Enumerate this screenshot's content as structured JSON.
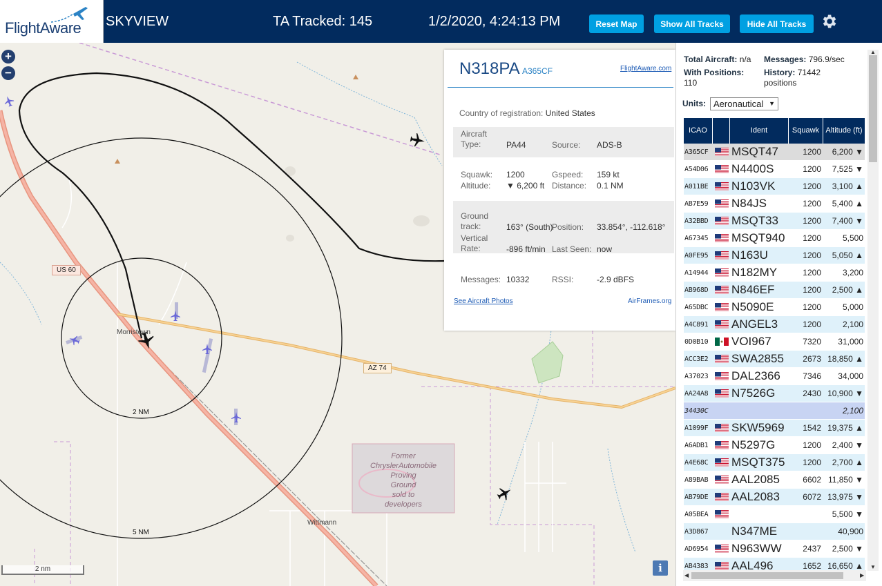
{
  "header": {
    "logo_text": "FlightAware",
    "app_name": "SKYVIEW",
    "tracked_label": "TA Tracked: 145",
    "datetime": "1/2/2020, 4:24:13 PM",
    "buttons": {
      "reset": "Reset Map",
      "show_all": "Show All Tracks",
      "hide_all": "Hide All Tracks"
    },
    "colors": {
      "bar": "#022b5e",
      "button": "#00a0e2"
    }
  },
  "map": {
    "zoom_in": "+",
    "zoom_out": "−",
    "labels": {
      "us60": "US 60",
      "az74": "AZ 74",
      "morristown": "Morristown",
      "wittmann": "Wittmann",
      "ring_2": "2 NM",
      "ring_5": "5 NM",
      "proving_ground": [
        "Former",
        "ChryslerAutomobile",
        "Proving",
        "Ground",
        "sold to",
        "developers"
      ]
    },
    "scale": "2 nm",
    "info_icon": "i"
  },
  "aircraft_panel": {
    "registration": "N318PA",
    "hex": "A365CF",
    "fa_link": "FlightAware.com",
    "country_label": "Country of registration:",
    "country": "United States",
    "aircraft_type_label": "Aircraft Type:",
    "aircraft_type": "PA44",
    "source_label": "Source:",
    "source": "ADS-B",
    "squawk_label": "Squawk:",
    "squawk": "1200",
    "gspeed_label": "Gspeed:",
    "gspeed": "159 kt",
    "altitude_label": "Altitude:",
    "altitude": "▼ 6,200 ft",
    "distance_label": "Distance:",
    "distance": "0.1 NM",
    "ground_track_label": "Ground track:",
    "ground_track": "163° (South)",
    "position_label": "Position:",
    "position": "33.854°, -112.618°",
    "vertical_rate_label": "Vertical Rate:",
    "vertical_rate": "-896 ft/min",
    "last_seen_label": "Last Seen:",
    "last_seen": "now",
    "messages_label": "Messages:",
    "messages": "10332",
    "rssi_label": "RSSI:",
    "rssi": "-2.9 dBFS",
    "photos_link": "See Aircraft Photos",
    "airframes_link": "AirFrames.org"
  },
  "sidebar": {
    "total_aircraft_label": "Total Aircraft:",
    "total_aircraft": "n/a",
    "messages_label": "Messages:",
    "messages": "796.9/sec",
    "with_positions_label": "With Positions:",
    "with_positions": "110",
    "history_label": "History:",
    "history": "71442 positions",
    "units_label": "Units:",
    "units_value": "Aeronautical",
    "columns": [
      "ICAO",
      "",
      "Ident",
      "Squawk",
      "Altitude (ft)"
    ],
    "rows": [
      {
        "icao": "A365CF",
        "flag": "us",
        "ident": "MSQT47",
        "squawk": "1200",
        "alt": "6,200 ▼",
        "style": "sel"
      },
      {
        "icao": "A54D06",
        "flag": "us",
        "ident": "N4400S",
        "squawk": "1200",
        "alt": "7,525 ▼",
        "style": "even"
      },
      {
        "icao": "A011BE",
        "flag": "us",
        "ident": "N103VK",
        "squawk": "1200",
        "alt": "3,100 ▲",
        "style": "odd"
      },
      {
        "icao": "AB7E59",
        "flag": "us",
        "ident": "N84JS",
        "squawk": "1200",
        "alt": "5,400 ▲",
        "style": "even"
      },
      {
        "icao": "A32BBD",
        "flag": "us",
        "ident": "MSQT33",
        "squawk": "1200",
        "alt": "7,400 ▼",
        "style": "odd"
      },
      {
        "icao": "A67345",
        "flag": "us",
        "ident": "MSQT940",
        "squawk": "1200",
        "alt": "5,500",
        "style": "even"
      },
      {
        "icao": "A0FE95",
        "flag": "us",
        "ident": "N163U",
        "squawk": "1200",
        "alt": "5,050 ▲",
        "style": "odd"
      },
      {
        "icao": "A14944",
        "flag": "us",
        "ident": "N182MY",
        "squawk": "1200",
        "alt": "3,200",
        "style": "even"
      },
      {
        "icao": "AB968D",
        "flag": "us",
        "ident": "N846EF",
        "squawk": "1200",
        "alt": "2,500 ▲",
        "style": "odd"
      },
      {
        "icao": "A65DBC",
        "flag": "us",
        "ident": "N5090E",
        "squawk": "1200",
        "alt": "5,000",
        "style": "even"
      },
      {
        "icao": "A4C891",
        "flag": "us",
        "ident": "ANGEL3",
        "squawk": "1200",
        "alt": "2,100",
        "style": "odd"
      },
      {
        "icao": "0D0B10",
        "flag": "mx",
        "ident": "VOI967",
        "squawk": "7320",
        "alt": "31,000",
        "style": "even"
      },
      {
        "icao": "ACC3E2",
        "flag": "us",
        "ident": "SWA2855",
        "squawk": "2673",
        "alt": "18,850 ▲",
        "style": "odd"
      },
      {
        "icao": "A37023",
        "flag": "us",
        "ident": "DAL2366",
        "squawk": "7346",
        "alt": "34,000",
        "style": "even"
      },
      {
        "icao": "AA24A8",
        "flag": "us",
        "ident": "N7526G",
        "squawk": "2430",
        "alt": "10,900 ▼",
        "style": "odd"
      },
      {
        "icao": "34430C",
        "flag": "",
        "ident": "",
        "squawk": "",
        "alt": "2,100",
        "style": "hl"
      },
      {
        "icao": "A1099F",
        "flag": "us",
        "ident": "SKW5969",
        "squawk": "1542",
        "alt": "19,375 ▲",
        "style": "odd"
      },
      {
        "icao": "A6ADB1",
        "flag": "us",
        "ident": "N5297G",
        "squawk": "1200",
        "alt": "2,400 ▼",
        "style": "even"
      },
      {
        "icao": "A4E68C",
        "flag": "us",
        "ident": "MSQT375",
        "squawk": "1200",
        "alt": "2,700 ▲",
        "style": "odd"
      },
      {
        "icao": "A89BAB",
        "flag": "us",
        "ident": "AAL2085",
        "squawk": "6602",
        "alt": "11,850 ▼",
        "style": "even"
      },
      {
        "icao": "AB79DE",
        "flag": "us",
        "ident": "AAL2083",
        "squawk": "6072",
        "alt": "13,975 ▼",
        "style": "odd"
      },
      {
        "icao": "A05BEA",
        "flag": "us",
        "ident": "",
        "squawk": "",
        "alt": "5,500 ▼",
        "style": "even"
      },
      {
        "icao": "A3D867",
        "flag": "",
        "ident": "N347ME",
        "squawk": "",
        "alt": "40,900",
        "style": "odd"
      },
      {
        "icao": "AD6954",
        "flag": "us",
        "ident": "N963WW",
        "squawk": "2437",
        "alt": "2,500 ▼",
        "style": "even"
      },
      {
        "icao": "AB4383",
        "flag": "us",
        "ident": "AAL496",
        "squawk": "1652",
        "alt": "16,650 ▲",
        "style": "odd"
      }
    ]
  }
}
